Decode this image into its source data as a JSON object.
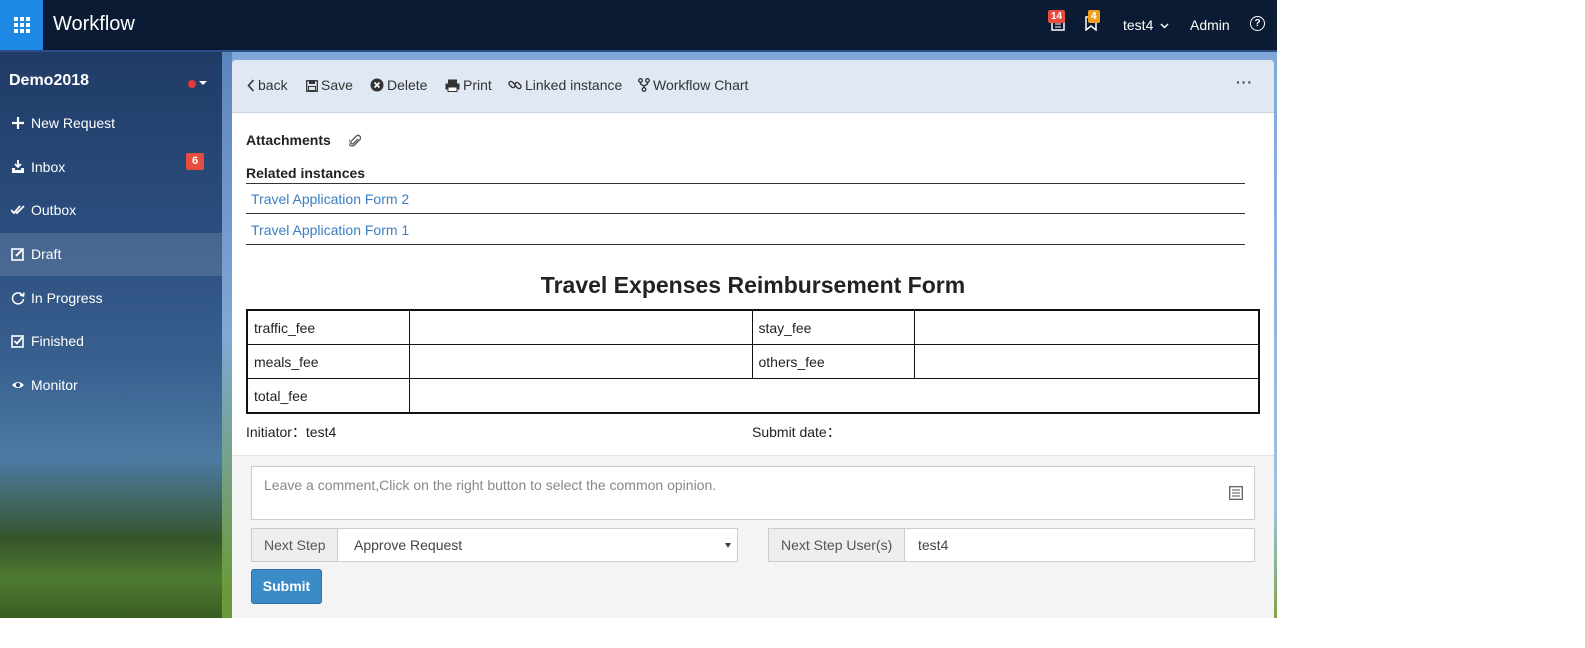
{
  "app": {
    "title": "Workflow"
  },
  "topbar": {
    "notifications_count": "14",
    "bookmarks_count": "4",
    "user": "test4",
    "admin_label": "Admin",
    "help": "?"
  },
  "sidebar": {
    "org": "Demo2018",
    "items": [
      {
        "label": "New Request",
        "icon": "plus-icon"
      },
      {
        "label": "Inbox",
        "icon": "inbox-icon",
        "badge": "6"
      },
      {
        "label": "Outbox",
        "icon": "double-check-icon"
      },
      {
        "label": "Draft",
        "icon": "edit-icon",
        "active": true
      },
      {
        "label": "In Progress",
        "icon": "refresh-icon"
      },
      {
        "label": "Finished",
        "icon": "checkbox-icon"
      },
      {
        "label": "Monitor",
        "icon": "eye-icon"
      }
    ]
  },
  "toolbar": {
    "back": "back",
    "save": "Save",
    "delete": "Delete",
    "print": "Print",
    "linked": "Linked instance",
    "chart": "Workflow Chart",
    "more": "···"
  },
  "attachments": {
    "title": "Attachments"
  },
  "related": {
    "title": "Related instances",
    "items": [
      "Travel Application Form 2",
      "Travel Application Form 1"
    ]
  },
  "form": {
    "title": "Travel Expenses Reimbursement Form",
    "fields": {
      "traffic": "traffic_fee",
      "stay": "stay_fee",
      "meals": "meals_fee",
      "others": "others_fee",
      "total": "total_fee"
    },
    "initiator": "Initiator：test4",
    "submit_date": "Submit date："
  },
  "comment": {
    "placeholder": "Leave a comment,Click on the right button to select the common opinion."
  },
  "next_step": {
    "label": "Next Step",
    "value": "Approve Request"
  },
  "next_users": {
    "label": "Next Step User(s)",
    "value": "test4"
  },
  "submit_label": "Submit",
  "colors": {
    "accent": "#1e88e5",
    "link": "#3a7ec4",
    "badge": "#e74c3c",
    "submit": "#3b8bc7"
  }
}
